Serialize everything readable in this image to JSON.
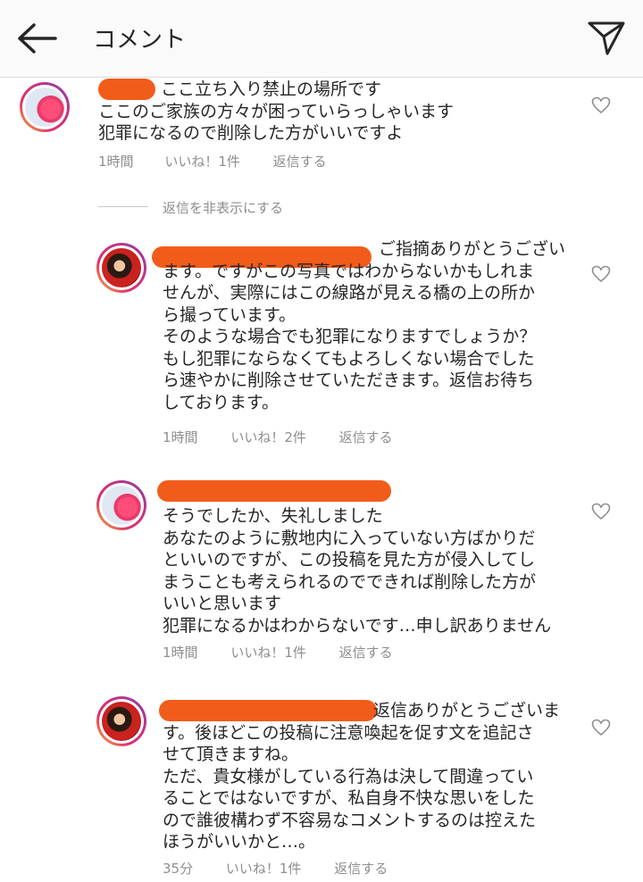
{
  "header": {
    "title": "コメント",
    "back_icon": "back-arrow-icon",
    "send_icon": "paper-plane-icon"
  },
  "hide_replies_label": "返信を非表示にする",
  "comments": [
    {
      "text": "ここ立ち入り禁止の場所です\nここのご家族の方々が困っていらっしゃいます\n犯罪になるので削除した方がいいですよ",
      "time": "1時間",
      "likes": "いいね！1件",
      "reply": "返信する"
    },
    {
      "text": "ご指摘ありがとうござい\nます。ですがこの写真ではわからないかもしれま\nせんが、実際にはこの線路が見える橋の上の所か\nら撮っています。\nそのような場合でも犯罪になりますでしょうか？\nもし犯罪にならなくてもよろしくない場合でした\nら速やかに削除させていただきます。返信お待ち\nしております。",
      "time": "1時間",
      "likes": "いいね！2件",
      "reply": "返信する"
    },
    {
      "text": "そうでしたか、失礼しました\nあなたのように敷地内に入っていない方ばかりだ\nといいのですが、この投稿を見た方が侵入してし\nまうことも考えられるのでできれば削除した方が\nいいと思います\n犯罪になるかはわからないです…申し訳ありません",
      "time": "1時間",
      "likes": "いいね！1件",
      "reply": "返信する"
    },
    {
      "text": "返信ありがとうございま\nす。後ほどこの投稿に注意喚起を促す文を追記さ\nせて頂きますね。\nただ、貴女様がしている行為は決して間違ってい\nることではないですが、私自身不快な思いをした\nので誰彼構わず不容易なコメントするのは控えた\nほうがいいかと…。",
      "time": "35分",
      "likes": "いいね！1件",
      "reply": "返信する"
    }
  ]
}
